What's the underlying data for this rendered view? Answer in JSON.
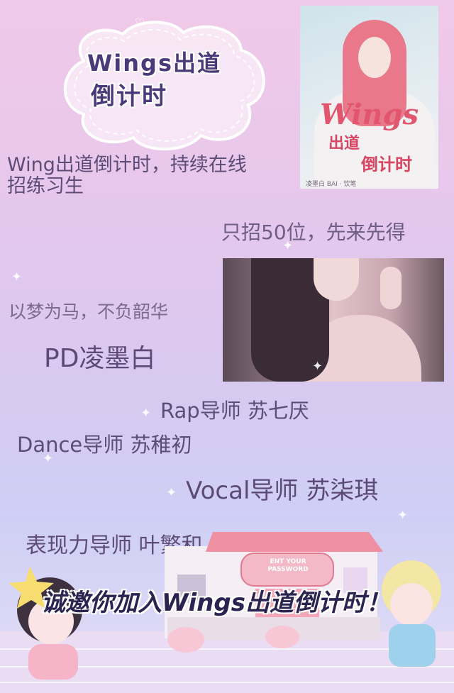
{
  "title": {
    "line1": "Wings出道",
    "line2": "倒计时"
  },
  "poster": {
    "title": "Wings",
    "subtitle_line1": "出道",
    "subtitle_line2": "倒计时",
    "credit": "凌墨白 BAI · 饮笔"
  },
  "lines": {
    "countdown_line1": "Wing出道倒计时，持续在线",
    "countdown_line2": "招练习生",
    "limit": "只招50位，先来先得",
    "dream": "以梦为马，不负韶华",
    "pd": "PD凌墨白",
    "rap": "Rap导师 苏七厌",
    "dance": "Dance导师  苏稚初",
    "vocal": "Vocal导师 苏柒琪",
    "expression": "表现力导师  叶繁和",
    "invite": "诚邀你加入Wings出道倒计时！"
  },
  "shop_sign": "ENT YOUR PASSWORD",
  "colors": {
    "bg_top": "#f1c9e8",
    "bg_bottom": "#cfcff5",
    "text": "#5d4d76",
    "poster_accent": "#e2556e"
  }
}
